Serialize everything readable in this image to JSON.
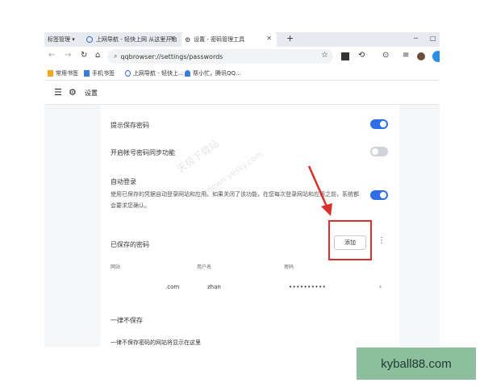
{
  "tabs": {
    "group_label": "标签管理 ▾",
    "items": [
      {
        "label": "上网导航 - 轻快上网 从这里开始"
      },
      {
        "label": "设置 - 密码管理工具"
      }
    ],
    "new_tab": "+",
    "minimize": "─",
    "maximize": "□"
  },
  "address_bar": {
    "url": "qqbrowser://settings/passwords"
  },
  "bookmarks": [
    {
      "label": "常用书签"
    },
    {
      "label": "手机书签"
    },
    {
      "label": "上网导航 - 轻快上..."
    },
    {
      "label": "帮小忙，腾讯QQ..."
    }
  ],
  "settings": {
    "title": "设置"
  },
  "rows": {
    "save_prompt": {
      "label": "提示保存密码",
      "enabled": true
    },
    "account_sync": {
      "label": "开启帐号密码同步功能",
      "enabled": false
    },
    "auto_login": {
      "label": "自动登录",
      "description": "使用已保存的凭据自动登录网站和应用。如果关闭了该功能，在您每次登录网站和应用之前，系统都会要求您确认。",
      "enabled": true
    }
  },
  "saved_passwords": {
    "title": "已保存的密码",
    "add_button": "添加",
    "columns": [
      "网站",
      "用户名",
      "密码"
    ],
    "entries": [
      {
        "site": ".com",
        "username": "zhan",
        "password": "••••••••••"
      }
    ]
  },
  "never_saved": {
    "title": "一律不保存",
    "empty_text": "一律不保存密码的网站将显示在这里"
  },
  "watermark": {
    "line1": "天极下载站",
    "line2": "mydown.yesky.com"
  },
  "site_badge": "kyball88.com",
  "colors": {
    "accent": "#2f6ee6",
    "annotation_red": "#d9302b",
    "badge_bg": "#8dbf9f"
  }
}
